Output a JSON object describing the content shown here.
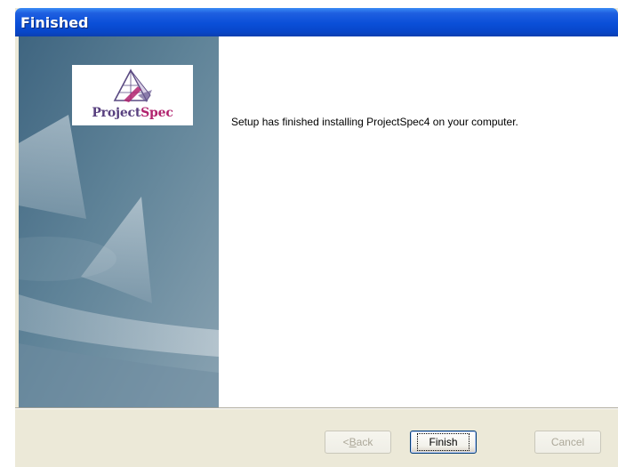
{
  "window": {
    "title": "Finished"
  },
  "logo": {
    "part1": "Project",
    "part2": "Spec"
  },
  "content": {
    "message": "Setup has finished installing ProjectSpec4 on your computer."
  },
  "buttons": {
    "back_mnemonic": "B",
    "back_rest": "ack",
    "back_prefix": "< ",
    "finish": "Finish",
    "cancel": "Cancel"
  },
  "colors": {
    "title_bar": "#0a4fd8",
    "dialog_bg": "#ece9d8",
    "side_panel": "#5d7f95",
    "logo_purple": "#58407f",
    "logo_magenta": "#b1236e"
  }
}
